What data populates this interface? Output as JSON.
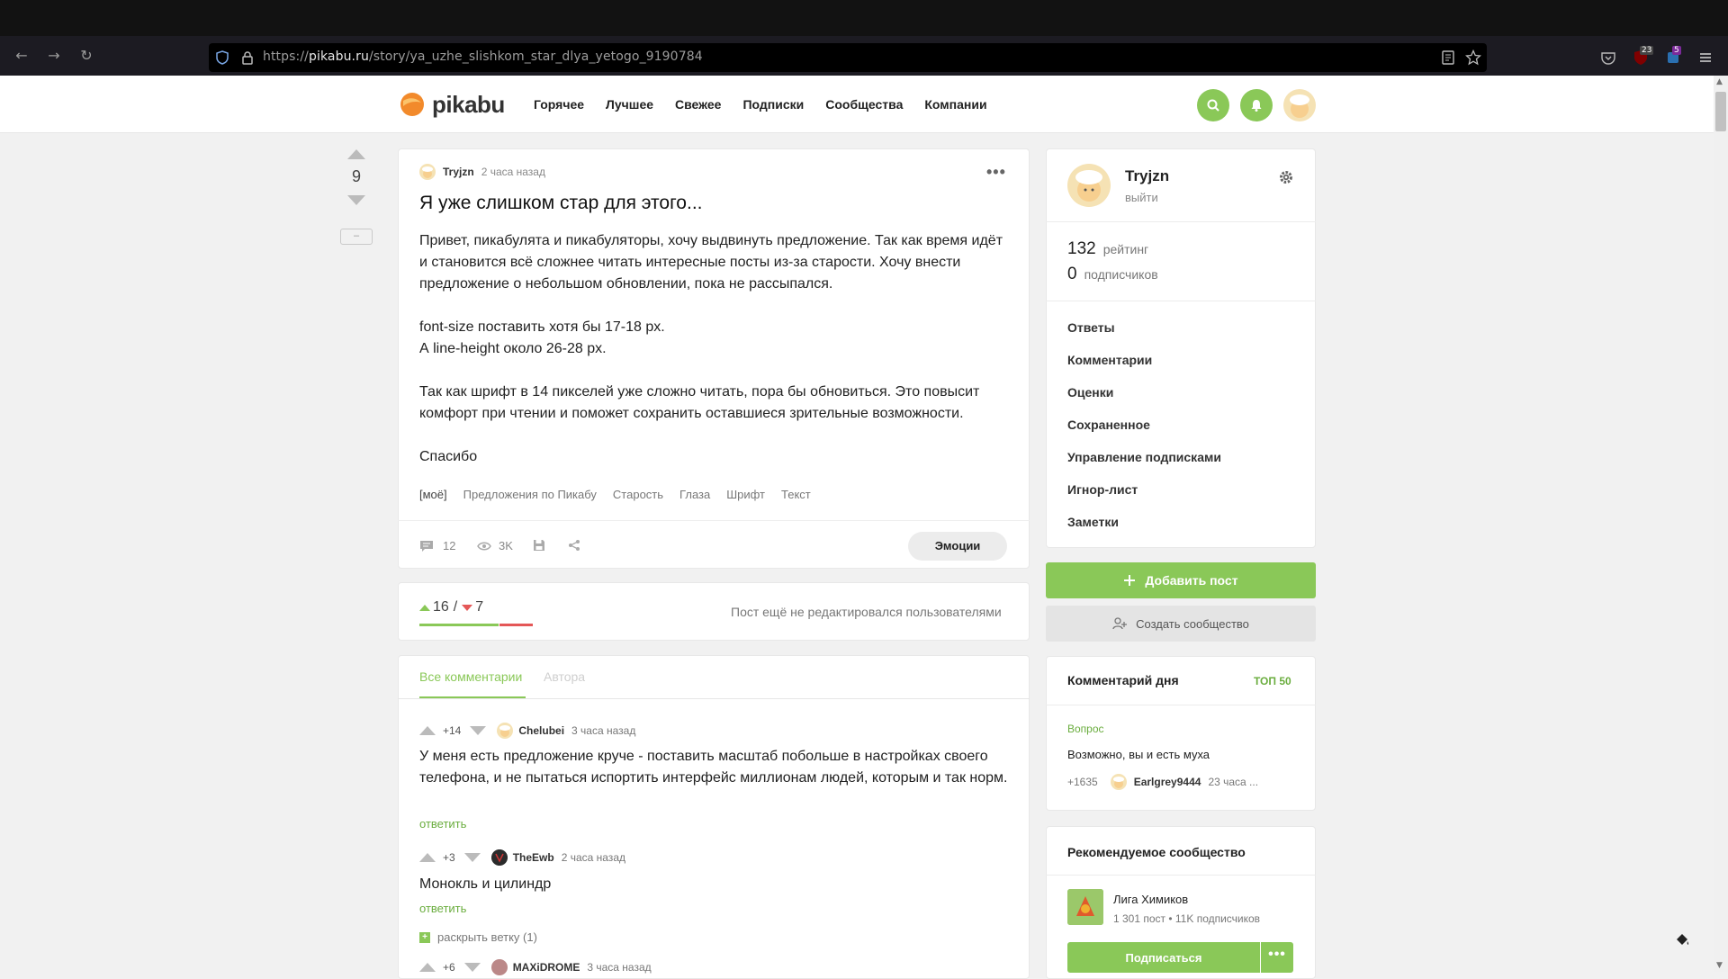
{
  "browser": {
    "url_prefix": "https://",
    "url_host": "pikabu.ru",
    "url_path": "/story/ya_uzhe_slishkom_star_dlya_yetogo_9190784",
    "ext_badge_1": "23",
    "ext_badge_2": "5"
  },
  "site": {
    "logo_text": "pikabu",
    "nav": [
      "Горячее",
      "Лучшее",
      "Свежее",
      "Подписки",
      "Сообщества",
      "Компании"
    ]
  },
  "story": {
    "rating": "9",
    "minus_label": "–",
    "author": "Tryjzn",
    "time": "2 часа назад",
    "title": "Я уже слишком стар для этого...",
    "paragraphs": [
      "Привет, пикабулята и пикабуляторы, хочу выдвинуть предложение. Так как время идёт и становится всё сложнее читать интересные посты из-за старости. Хочу внести предложение о небольшом обновлении, пока не рассыпался.",
      "font-size поставить хотя бы 17-18 px.\nА line-height около 26-28 px.",
      "Так как шрифт в 14 пикселей уже сложно читать, пора бы обновиться. Это повысит комфорт при чтении и поможет сохранить оставшиеся зрительные возможности.",
      "Спасибо"
    ],
    "tags": [
      "[моё]",
      "Предложения по Пикабу",
      "Старость",
      "Глаза",
      "Шрифт",
      "Текст"
    ],
    "comments_count": "12",
    "views": "3K",
    "emotions_label": "Эмоции"
  },
  "rating": {
    "up": "16",
    "separator": "/",
    "down": "7",
    "up_share": 0.7,
    "note": "Пост ещё не редактировался пользователями"
  },
  "comments": {
    "tab_all": "Все комментарии",
    "tab_author": "Автора",
    "items": [
      {
        "score": "+14",
        "user": "Chelubei",
        "time": "3 часа назад",
        "text": "У меня есть предложение круче - поставить масштаб побольше в настройках своего телефона, и не пытаться испортить интерфейс миллионам людей, которым и так норм.",
        "reply": "ответить"
      },
      {
        "score": "+3",
        "user": "TheEwb",
        "time": "2 часа назад",
        "text": "Монокль и цилиндр",
        "reply": "ответить"
      },
      {
        "score": "+6",
        "user": "MAXiDROME",
        "time": "3 часа назад"
      }
    ],
    "expand_label": "раскрыть ветку (1)"
  },
  "profile": {
    "name": "Tryjzn",
    "logout": "выйти",
    "rating_value": "132",
    "rating_label": "рейтинг",
    "subs_value": "0",
    "subs_label": "подписчиков",
    "menu": [
      "Ответы",
      "Комментарии",
      "Оценки",
      "Сохраненное",
      "Управление подписками",
      "Игнор-лист",
      "Заметки"
    ]
  },
  "actions": {
    "add_post": "Добавить пост",
    "create_community": "Создать сообщество"
  },
  "comment_of_day": {
    "title": "Комментарий дня",
    "top_link": "ТОП 50",
    "question": "Вопрос",
    "text": "Возможно, вы и есть муха",
    "score": "+1635",
    "user": "Earlgrey9444",
    "time": "23 часа ..."
  },
  "recommended": {
    "title": "Рекомендуемое сообщество",
    "name": "Лига Химиков",
    "meta": "1 301 пост  •  11K подписчиков",
    "subscribe": "Подписаться"
  },
  "colors": {
    "accent_green": "#8ac858",
    "downvote_red": "#e45757",
    "link_green": "#6aad3e"
  }
}
